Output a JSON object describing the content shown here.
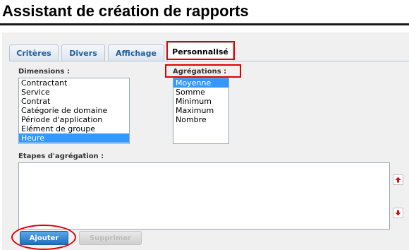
{
  "header": {
    "title": "Assistant de création de rapports"
  },
  "tabs": [
    {
      "label": "Critères",
      "active": false
    },
    {
      "label": "Divers",
      "active": false
    },
    {
      "label": "Affichage",
      "active": false
    },
    {
      "label": "Personnalisé",
      "active": true
    }
  ],
  "dimensions": {
    "label": "Dimensions :",
    "options": [
      "Contractant",
      "Service",
      "Contrat",
      "Catégorie de domaine",
      "Période d'application",
      "Elément de groupe",
      "Heure"
    ],
    "selected": "Heure"
  },
  "aggregations": {
    "label": "Agrégations :",
    "options": [
      "Moyenne",
      "Somme",
      "Minimum",
      "Maximum",
      "Nombre"
    ],
    "selected": "Moyenne"
  },
  "steps": {
    "label": "Etapes d'agrégation :"
  },
  "actions": {
    "add_label": "Ajouter",
    "delete_label": "Supprimer"
  },
  "colors": {
    "highlight": "#e00000",
    "accent": "#1f6fbf",
    "selection": "#3399ff"
  },
  "icons": {
    "move_up": "arrow-up-icon",
    "move_down": "arrow-down-icon"
  }
}
